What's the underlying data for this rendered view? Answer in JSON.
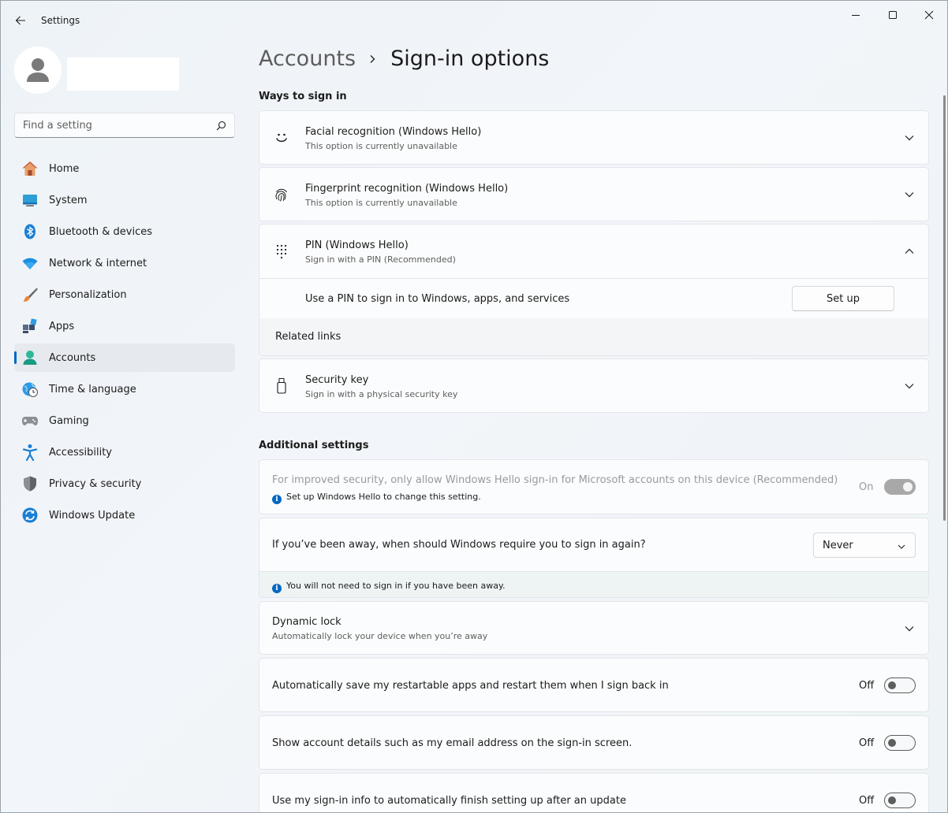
{
  "window": {
    "title": "Settings"
  },
  "search": {
    "placeholder": "Find a setting"
  },
  "sidebar": {
    "items": [
      {
        "label": "Home",
        "icon": "home-icon"
      },
      {
        "label": "System",
        "icon": "system-icon"
      },
      {
        "label": "Bluetooth & devices",
        "icon": "bluetooth-icon"
      },
      {
        "label": "Network & internet",
        "icon": "network-icon"
      },
      {
        "label": "Personalization",
        "icon": "personalization-icon"
      },
      {
        "label": "Apps",
        "icon": "apps-icon"
      },
      {
        "label": "Accounts",
        "icon": "accounts-icon",
        "active": true
      },
      {
        "label": "Time & language",
        "icon": "time-language-icon"
      },
      {
        "label": "Gaming",
        "icon": "gaming-icon"
      },
      {
        "label": "Accessibility",
        "icon": "accessibility-icon"
      },
      {
        "label": "Privacy & security",
        "icon": "privacy-icon"
      },
      {
        "label": "Windows Update",
        "icon": "windows-update-icon"
      }
    ]
  },
  "breadcrumb": {
    "parent": "Accounts",
    "current": "Sign-in options"
  },
  "ways": {
    "title": "Ways to sign in",
    "facial": {
      "title": "Facial recognition (Windows Hello)",
      "sub": "This option is currently unavailable"
    },
    "fingerprint": {
      "title": "Fingerprint recognition (Windows Hello)",
      "sub": "This option is currently unavailable"
    },
    "pin": {
      "title": "PIN (Windows Hello)",
      "sub": "Sign in with a PIN (Recommended)",
      "setup_text": "Use a PIN to sign in to Windows, apps, and services",
      "setup_button": "Set up",
      "related": "Related links"
    },
    "security_key": {
      "title": "Security key",
      "sub": "Sign in with a physical security key"
    }
  },
  "additional": {
    "title": "Additional settings",
    "hello_only": {
      "text": "For improved security, only allow Windows Hello sign-in for Microsoft accounts on this device (Recommended)",
      "note": "Set up Windows Hello to change this setting.",
      "state": "On"
    },
    "away": {
      "text": "If you’ve been away, when should Windows require you to sign in again?",
      "value": "Never",
      "note": "You will not need to sign in if you have been away."
    },
    "dynamic_lock": {
      "title": "Dynamic lock",
      "sub": "Automatically lock your device when you’re away"
    },
    "restart_apps": {
      "text": "Automatically save my restartable apps and restart them when I sign back in",
      "state": "Off"
    },
    "account_details": {
      "text": "Show account details such as my email address on the sign-in screen.",
      "state": "Off"
    },
    "signin_info": {
      "text": "Use my sign-in info to automatically finish setting up after an update",
      "state": "Off"
    }
  },
  "colors": {
    "accent": "#0067c0"
  }
}
